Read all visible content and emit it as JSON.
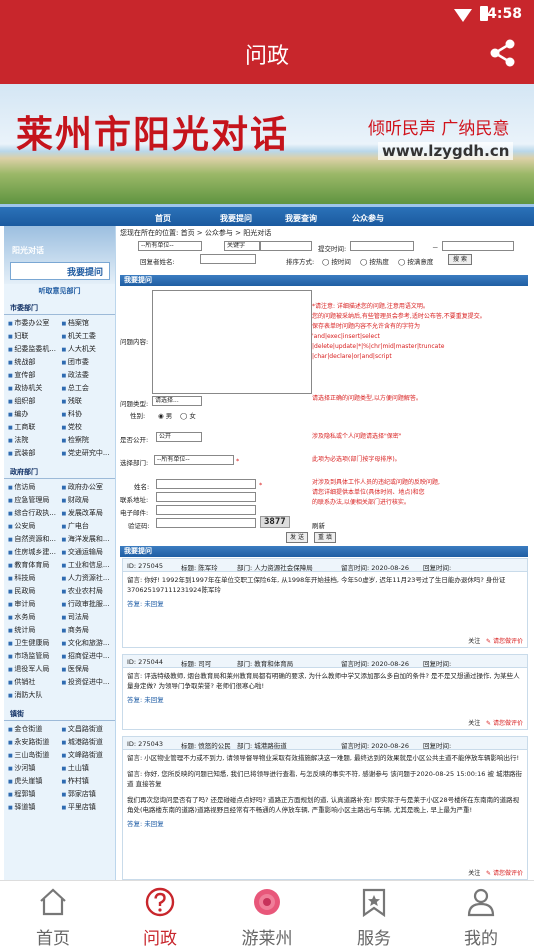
{
  "status_bar": {
    "time": "4:58"
  },
  "app_header": {
    "title": "问政"
  },
  "banner": {
    "title": "莱州市阳光对话",
    "slogan": "倾听民声 广纳民意",
    "url": "www.lzygdh.cn"
  },
  "site_nav": {
    "items": [
      "首页",
      "我要提问",
      "我要查询",
      "公众参与"
    ]
  },
  "sidebar": {
    "title": "阳光对话",
    "ask_button": "我要提问",
    "section_title": "听取意见部门",
    "groups": [
      {
        "title": "市委部门",
        "items": [
          "市委办公室",
          "档案馆",
          "妇联",
          "机关工委",
          "纪委监委机...",
          "人大机关",
          "统战部",
          "团市委",
          "宣传部",
          "政法委",
          "政协机关",
          "总工会",
          "组织部",
          "残联",
          "编办",
          "科协",
          "工商联",
          "党校",
          "法院",
          "检察院",
          "武装部",
          "党史研究中..."
        ]
      },
      {
        "title": "政府部门",
        "items": [
          "信访局",
          "政府办公室",
          "应急管理局",
          "财政局",
          "综合行政执...",
          "发展改革局",
          "公安局",
          "广电台",
          "自然资源和...",
          "海洋发展和...",
          "住房城乡建...",
          "交通运输局",
          "教育体育局",
          "工业和信息...",
          "科技局",
          "人力资源社...",
          "民政局",
          "农业农村局",
          "审计局",
          "行政审批服...",
          "水务局",
          "司法局",
          "统计局",
          "商务局",
          "卫生健康局",
          "文化和旅游...",
          "市场监管局",
          "招商促进中...",
          "退役军人局",
          "医保局",
          "供销社",
          "投资促进中...",
          "消防大队"
        ]
      },
      {
        "title": "镇街",
        "items": [
          "金仓街道",
          "文昌路街道",
          "永安路街道",
          "城港路街道",
          "三山岛街道",
          "文峰路街道",
          "沙河镇",
          "土山镇",
          "虎头崖镇",
          "柞村镇",
          "程郭镇",
          "郭家店镇",
          "驿道镇",
          "平里店镇"
        ]
      }
    ]
  },
  "form": {
    "breadcrumb": "您现在所在的位置: 首页 > 公众参与 > 阳光对话",
    "filter_dept": "--所有单位--",
    "filter_keyword": "关键字",
    "filter_time_label": "提交时间:",
    "filter_reply_label": "回复者姓名:",
    "sort_label": "排序方式:",
    "sort_options": [
      "按时间",
      "按热度",
      "按满意度"
    ],
    "search_button": "搜 索",
    "section_title": "我要提问",
    "content_label": "问题内容:",
    "content_hints": [
      "*请注意: 详细描述您的问题,注意用语文明。",
      "您的问题被采纳后,有些管理员会参考,适时公布答,不要重复提交。",
      "保存表单时问题内容不允许含有的字符为",
      "'and|exec|insert|select",
      "|delete|update|*|%|chr|mid|master|truncate",
      "|char|declare|or|and|script"
    ],
    "type_label": "问题类型:",
    "type_value": "请选择...",
    "type_hint": "请选择正确的问题类型,以方便问题解答。",
    "gender_label": "性别:",
    "gender_male": "男",
    "gender_female": "女",
    "public_label": "是否公开:",
    "public_value": "公开",
    "public_hint": "涉及隐私或个人问题请选择\"保密\"",
    "dept_label": "选择部门:",
    "dept_value": "--所有单位--",
    "dept_hint": "此项为必选项(部门按字母排序)。",
    "name_label": "姓名:",
    "address_label": "联系地址:",
    "email_label": "电子邮件:",
    "captcha_label": "验证码:",
    "captcha_value": "3877",
    "refresh_label": "刷新",
    "contact_hints": [
      "对涉及到具体工作人员的违纪或问题的反映问题,",
      "请您详细提供本单位(具体时间、地点)和您",
      "的联系办法,以便相关部门进行核实。"
    ],
    "submit_button": "发 送",
    "reset_button": "重 填"
  },
  "questions_section": {
    "title": "我要提问"
  },
  "questions": [
    {
      "id": "ID: 275045",
      "title": "标题: 陈军玲",
      "dept": "部门: 人力资源社会保障局",
      "time": "留言时间: 2020-08-26",
      "status": "回复时间:",
      "text": "留言: 你好! 1992年到1997年在单位交职工保险6年, 从1998年开始挂档, 今年50虚岁, 迟年11月23号过了生日能办退休吗? 身份证370625197111231924陈军玲",
      "reply": "答复: 未回复",
      "follow": "关注",
      "evaluate": "请您做评价"
    },
    {
      "id": "ID: 275044",
      "title": "标题: 司可",
      "dept": "部门: 教育和体育局",
      "time": "留言时间: 2020-08-26",
      "status": "回复时间:",
      "text": "留言: 评选特级教师, 烟台教育局和莱州教育局都有明确的要求, 为什么教师中学又添加那么多自加的条件? 是不是又想通过操作, 为某些人量身定做? 为领导门争取荣誉? 老师们很寒心啦!",
      "reply": "答复: 未回复",
      "follow": "关注",
      "evaluate": "请您做评价"
    },
    {
      "id": "ID: 275043",
      "title": "标题: 愤怒的公民",
      "dept": "部门: 城港路街道",
      "time": "留言时间: 2020-08-26",
      "status": "回复时间:",
      "text": "留言: 小区物业管理不力或不到力, 请领导督导物业采取有效措施解决这一难题, 最终达到的效果就是小区公共主道不能停放车辆影响出行!",
      "reply2": "留言: 你好, 您所反映的问题已知悉, 我们已将领导进行查看, 与怎反映的事实不符, 感谢参与 该问题于2020-08-25 15:00:16 被 城港路街道 直接答复",
      "text2": "我们再次您询问是否有了吗? 还是碰碰点点好吗? 道路正方面规划的道, 认真道路补充! 即实际于与是莱于小区28号楼所在东南南的道路视角处(电路楼东南的道路)道路视野且经常有不畅通的人停放车辆, 严重影响小区主路出与车辆, 尤其是晚上, 早上最为严重!",
      "reply": "答复: 未回复",
      "follow": "关注",
      "evaluate": "请您做评价"
    }
  ],
  "bottom_tabs": [
    {
      "label": "首页"
    },
    {
      "label": "问政"
    },
    {
      "label": "游莱州"
    },
    {
      "label": "服务"
    },
    {
      "label": "我的"
    }
  ],
  "colors": {
    "brand": "#c8262c",
    "site_blue": "#1f5ea3"
  }
}
